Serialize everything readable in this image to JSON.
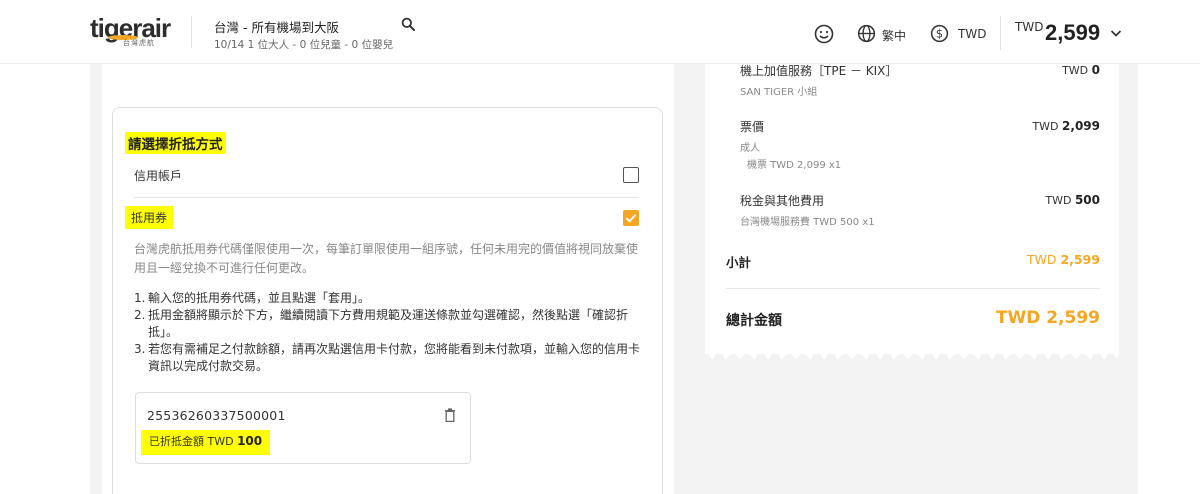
{
  "header": {
    "logo_text": "tigerair",
    "logo_sub": "台灣虎航",
    "route_title": "台灣 - 所有機場到大阪",
    "route_sub": "10/14  1 位大人 - 0 位兒童 - 0 位嬰兒",
    "language": "繁中",
    "currency": "TWD",
    "total_currency": "TWD",
    "total_amount": "2,599"
  },
  "payment": {
    "title": "請選擇折抵方式",
    "credit_label": "信用帳戶",
    "voucher_label": "抵用券",
    "credit_checked": false,
    "voucher_checked": true,
    "description": "台灣虎航抵用券代碼僅限使用一次，每筆訂單限使用一組序號，任何未用完的價值將視同放棄使用且一經兌換不可進行任何更改。",
    "steps": [
      {
        "num": "1.",
        "text": "輸入您的抵用券代碼，並且點選「套用」。"
      },
      {
        "num": "2.",
        "text": "抵用金額將顯示於下方，繼續閱讀下方費用規範及運送條款並勾選確認，然後點選「確認折抵」。"
      },
      {
        "num": "3.",
        "text": "若您有需補足之付款餘額，請再次點選信用卡付款，您將能看到未付款項，並輸入您的信用卡資訊以完成付款交易。"
      }
    ],
    "voucher_code": "25536260337500001",
    "deducted_label": "已折抵金額 TWD",
    "deducted_amount": "100"
  },
  "summary": {
    "items": [
      {
        "label": "機上加值服務［TPE － KIX］",
        "sub": "SAN TIGER 小組",
        "sub2": "",
        "currency": "TWD",
        "amount": "0"
      },
      {
        "label": "票價",
        "sub": "成人",
        "sub2": "機票 TWD 2,099 x1",
        "currency": "TWD",
        "amount": "2,099"
      },
      {
        "label": "稅金與其他費用",
        "sub": "台灣機場服務費 TWD 500 x1",
        "sub2": "",
        "currency": "TWD",
        "amount": "500"
      }
    ],
    "subtotal_label": "小計",
    "subtotal_currency": "TWD",
    "subtotal_amount": "2,599",
    "grand_label": "總計金額",
    "grand_amount": "TWD 2,599"
  },
  "colors": {
    "accent": "#f5a623",
    "highlight": "#ffff00"
  }
}
